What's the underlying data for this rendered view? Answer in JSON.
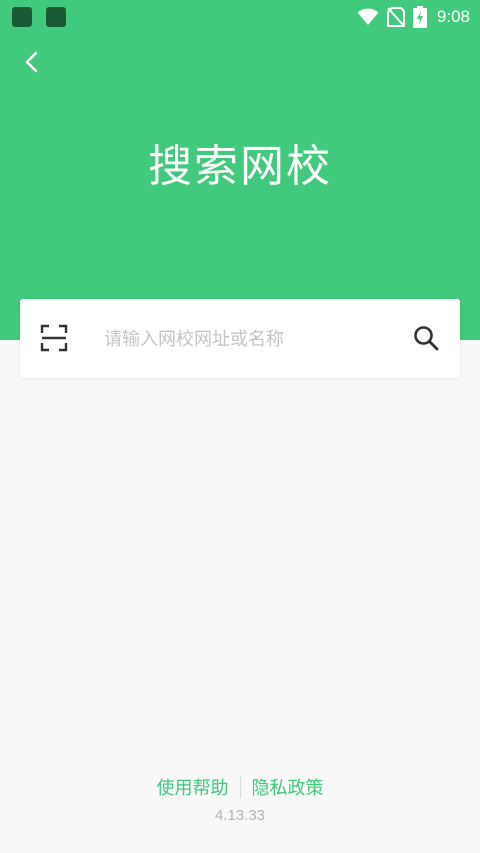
{
  "status_bar": {
    "time": "9:08",
    "icons": [
      "notification-icon",
      "notification-icon",
      "wifi-icon",
      "no-sim-icon",
      "battery-charging-icon"
    ]
  },
  "header": {
    "title": "搜索网校",
    "background_color": "#41c97d",
    "back_icon": "chevron-left-icon"
  },
  "search": {
    "placeholder": "请输入网校网址或名称",
    "value": "",
    "scan_icon": "scan-icon",
    "search_icon": "search-icon"
  },
  "footer": {
    "help_label": "使用帮助",
    "privacy_label": "隐私政策",
    "version": "4.13.33",
    "link_color": "#41c97d"
  }
}
